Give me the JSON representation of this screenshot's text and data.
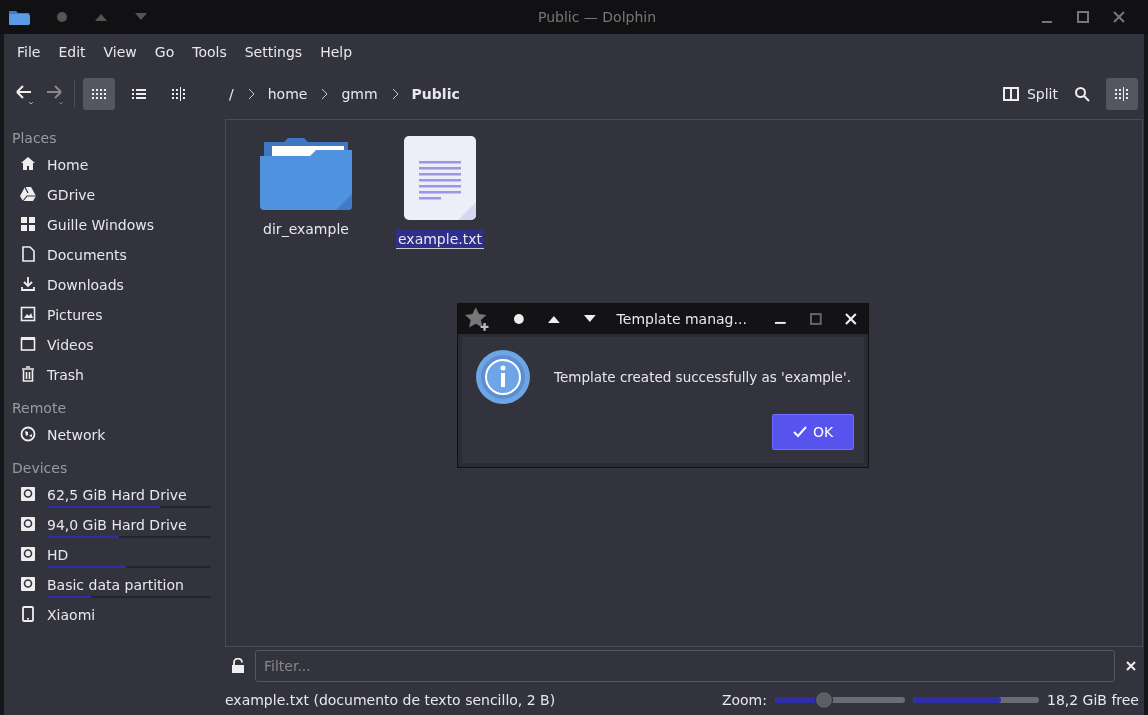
{
  "window": {
    "title": "Public — Dolphin"
  },
  "menu": [
    "File",
    "Edit",
    "View",
    "Go",
    "Tools",
    "Settings",
    "Help"
  ],
  "view_modes": [
    {
      "selected": true
    },
    {
      "selected": false
    },
    {
      "selected": false
    }
  ],
  "breadcrumb": [
    "/",
    "home",
    "gmm",
    "Public"
  ],
  "split_button": "Split",
  "sidebar": [
    {
      "heading": "Places",
      "items": [
        {
          "label": "Home"
        },
        {
          "label": "GDrive"
        },
        {
          "label": "Guille Windows"
        },
        {
          "label": "Documents"
        },
        {
          "label": "Downloads"
        },
        {
          "label": "Pictures"
        },
        {
          "label": "Videos"
        },
        {
          "label": "Trash"
        }
      ]
    },
    {
      "heading": "Remote",
      "items": [
        {
          "label": "Network"
        }
      ]
    },
    {
      "heading": "Devices",
      "items": [
        {
          "label": "62,5 GiB Hard Drive",
          "level": 0.69
        },
        {
          "label": "94,0 GiB Hard Drive",
          "level": 0.44
        },
        {
          "label": "HD",
          "level": 0.48
        },
        {
          "label": "Basic data partition",
          "level": 0.27
        },
        {
          "label": "Xiaomi"
        }
      ]
    }
  ],
  "files": [
    {
      "name": "dir_example",
      "kind": "folder",
      "selected": false
    },
    {
      "name": "example.txt",
      "kind": "text",
      "selected": true
    }
  ],
  "dialog": {
    "title": "Template manag...",
    "message": "Template created successfully as 'example'.",
    "button": "OK"
  },
  "filter": {
    "placeholder": "Filter..."
  },
  "status_bar": {
    "text": "example.txt (documento de texto sencillo, 2 B)",
    "zoom_label": "Zoom:",
    "zoom": {
      "level": 0.38
    },
    "space": {
      "level": 0.7
    },
    "free": "18,2 GiB free"
  }
}
